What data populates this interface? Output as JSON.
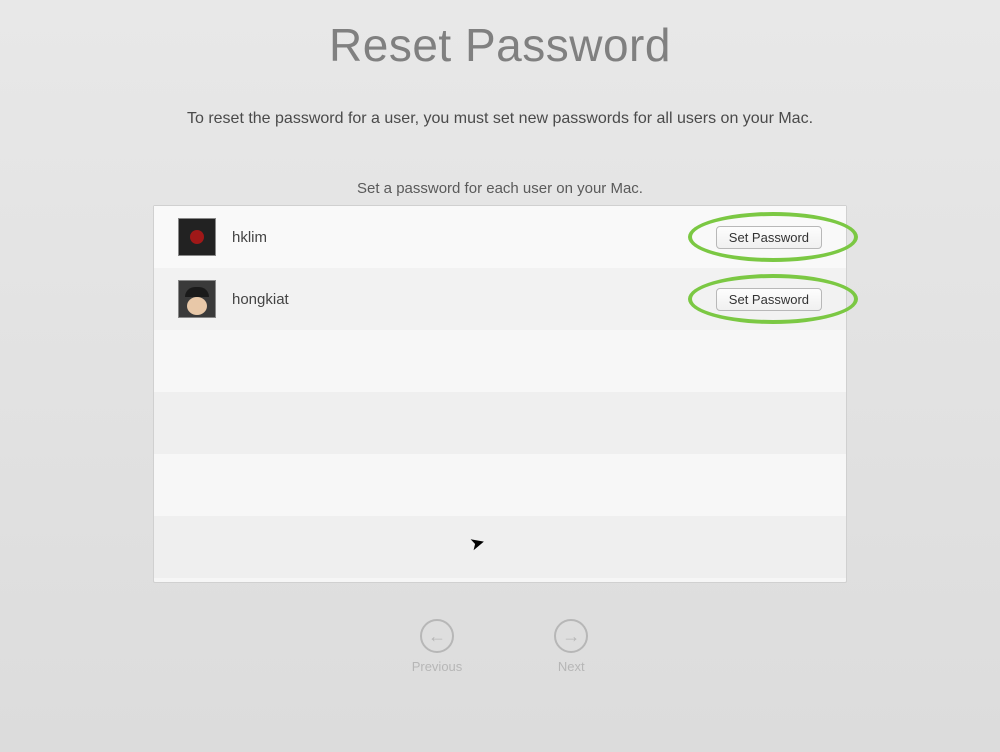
{
  "header": {
    "title": "Reset Password",
    "instruction": "To reset the password for a user, you must set new passwords for all users on your Mac.",
    "sub_instruction": "Set a password for each user on your Mac."
  },
  "users": [
    {
      "name": "hklim",
      "button_label": "Set Password"
    },
    {
      "name": "hongkiat",
      "button_label": "Set Password"
    }
  ],
  "nav": {
    "previous_label": "Previous",
    "next_label": "Next"
  }
}
